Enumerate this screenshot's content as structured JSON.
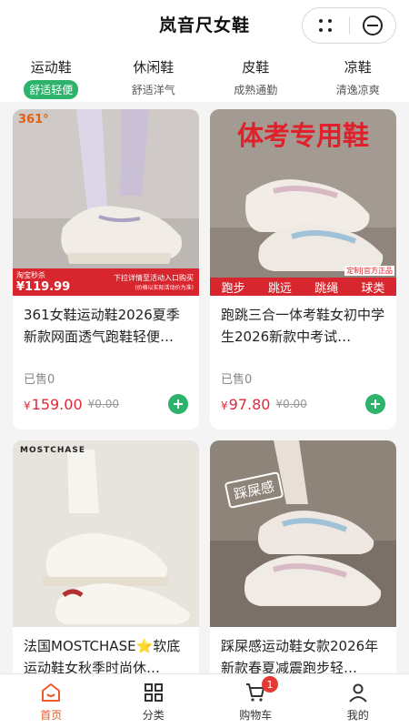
{
  "header": {
    "title": "岚音尺女鞋"
  },
  "tabs": [
    {
      "name": "运动鞋",
      "sub": "舒适轻便",
      "active": true
    },
    {
      "name": "休闲鞋",
      "sub": "舒适洋气",
      "active": false
    },
    {
      "name": "皮鞋",
      "sub": "成熟通勤",
      "active": false
    },
    {
      "name": "凉鞋",
      "sub": "清逸凉爽",
      "active": false
    }
  ],
  "products": [
    {
      "title": "361女鞋运动鞋2026夏季新款网面透气跑鞋轻便…",
      "sold": "已售0",
      "currency": "¥",
      "price": "159.00",
      "orig_price": "¥0.00",
      "img": {
        "brand": "361°",
        "tag": "淘宝秒杀",
        "promo_price": "¥119.99",
        "promo_line1": "下拉详情至活动入口购买",
        "promo_line2": "(价格以实际活动价为准)"
      }
    },
    {
      "title": "跑跳三合一体考鞋女初中学生2026新款中考试…",
      "sold": "已售0",
      "currency": "¥",
      "price": "97.80",
      "orig_price": "¥0.00",
      "img": {
        "headline": "体考专用鞋",
        "corner": "定制|官方正品",
        "footer": [
          "跑步",
          "跳远",
          "跳绳",
          "球类"
        ]
      }
    },
    {
      "title": "法国MOSTCHASE⭐软底运动鞋女秋季时尚休…",
      "sold": "",
      "currency": "",
      "price": "",
      "orig_price": "",
      "img": {
        "brand": "MOSTCHASE"
      }
    },
    {
      "title": "踩屎感运动鞋女款2026年新款春夏减震跑步轻…",
      "sold": "",
      "currency": "",
      "price": "",
      "orig_price": "",
      "img": {
        "stamp": "踩屎感"
      }
    }
  ],
  "tabbar": [
    {
      "label": "首页",
      "icon": "home-icon",
      "active": true
    },
    {
      "label": "分类",
      "icon": "category-icon",
      "active": false
    },
    {
      "label": "购物车",
      "icon": "cart-icon",
      "active": false,
      "badge": "1"
    },
    {
      "label": "我的",
      "icon": "user-icon",
      "active": false
    }
  ],
  "colors": {
    "accent_green": "#2db36b",
    "price_red": "#e0283a",
    "active_orange": "#e85a2a",
    "badge_red": "#e53935"
  }
}
